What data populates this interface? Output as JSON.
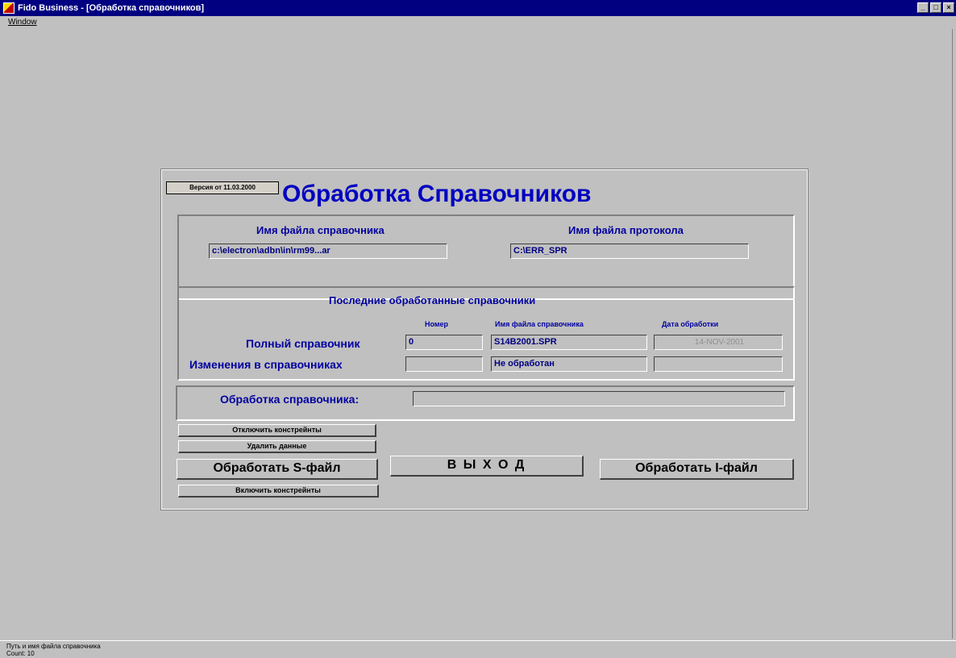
{
  "window": {
    "title": "Fido Business - [Обработка справочников]",
    "minimize": "_",
    "maximize": "□",
    "close": "×"
  },
  "menu": {
    "window": "Window"
  },
  "form": {
    "version": "Версия от 11.03.2000",
    "title": "Обработка Справочников",
    "files": {
      "ref_label": "Имя файла справочника",
      "ref_value": "c:\\electron\\adbn\\in\\rm99...ar",
      "log_label": "Имя файла протокола",
      "log_value": "C:\\ERR_SPR"
    },
    "last": {
      "heading": "Последние обработанные справочники",
      "col_number": "Номер",
      "col_file": "Имя файла справочника",
      "col_date": "Дата обработки",
      "rows": [
        {
          "label": "Полный справочник",
          "number": "0",
          "file": "S14B2001.SPR",
          "date": "14-NOV-2001"
        },
        {
          "label": "Изменения в справочниках",
          "number": "",
          "file": "Не обработан",
          "date": ""
        }
      ]
    },
    "processing": {
      "label": "Обработка справочника:",
      "value": ""
    },
    "buttons": {
      "disable_constraints": "Отключить констрейнты",
      "delete_data": "Удалить данные",
      "process_s": "Обработать S-файл",
      "enable_constraints": "Включить констрейнты",
      "exit": "В Ы Х О Д",
      "process_i": "Обработать I-файл"
    }
  },
  "status": {
    "line1": "Путь и имя файла справочника",
    "line2": "Count: 10"
  }
}
